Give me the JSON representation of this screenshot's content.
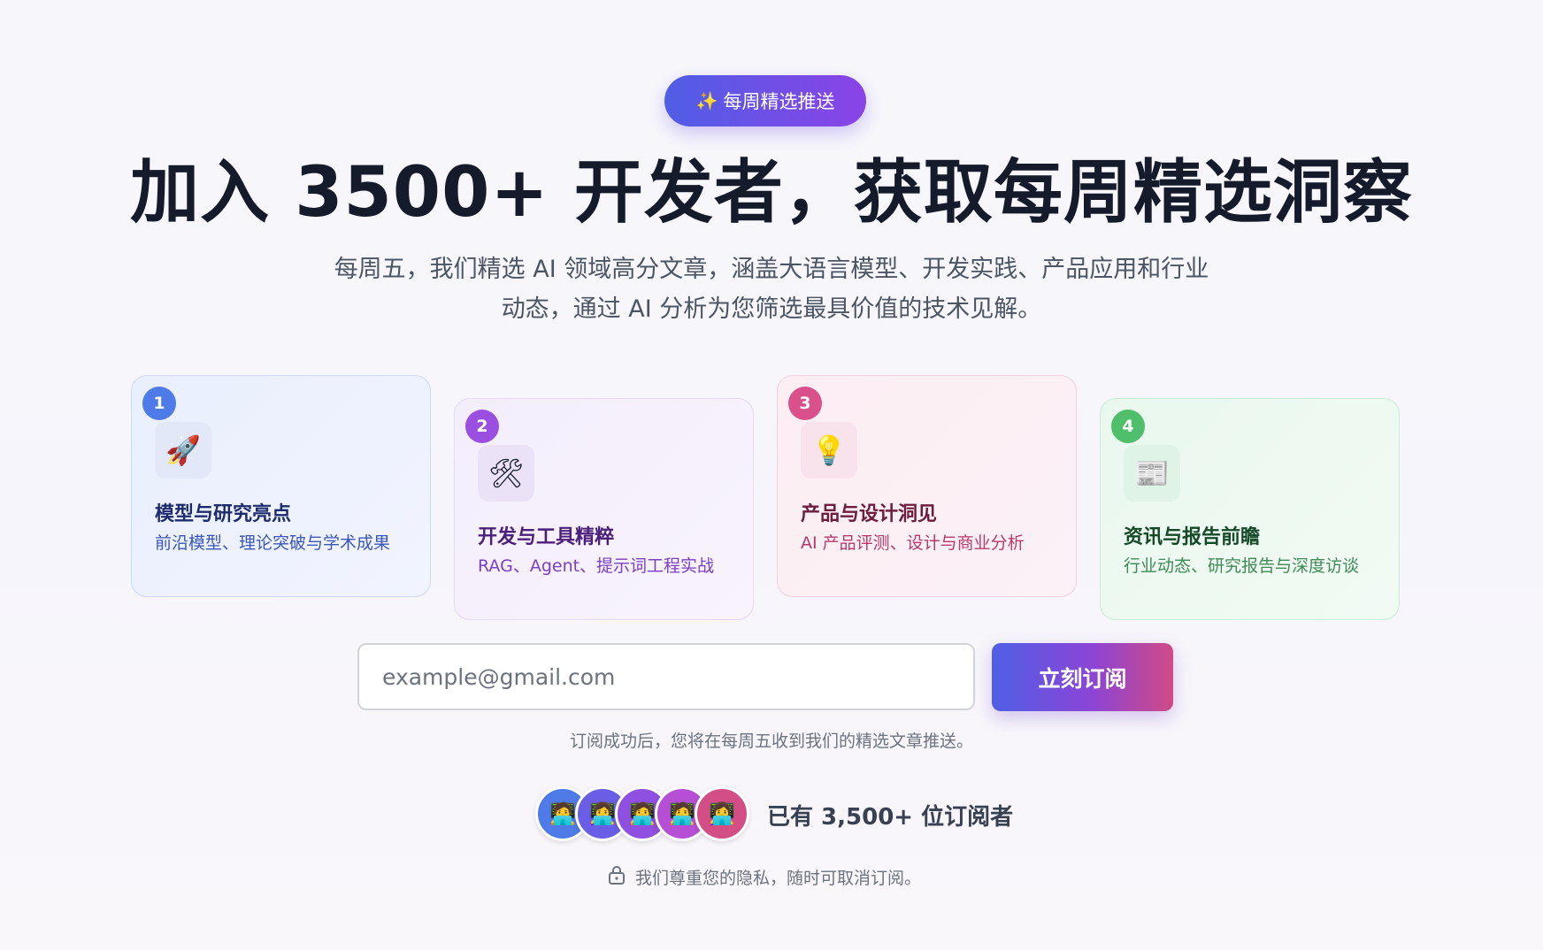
{
  "badge": {
    "icon": "sparkles-icon",
    "icon_glyph": "✨",
    "label": "每周精选推送"
  },
  "hero": {
    "title": "加入 3500+ 开发者，获取每周精选洞察",
    "subtitle_line1": "每周五，我们精选 AI 领域高分文章，涵盖大语言模型、开发实践、产品应用和行业",
    "subtitle_line2": "动态，通过 AI 分析为您筛选最具价值的技术见解。"
  },
  "cards": [
    {
      "number": "1",
      "icon": "rocket-icon",
      "icon_glyph": "🚀",
      "title": "模型与研究亮点",
      "desc": "前沿模型、理论突破与学术成果"
    },
    {
      "number": "2",
      "icon": "tools-icon",
      "icon_glyph": "🛠",
      "title": "开发与工具精粹",
      "desc": "RAG、Agent、提示词工程实战"
    },
    {
      "number": "3",
      "icon": "lightbulb-icon",
      "icon_glyph": "💡",
      "title": "产品与设计洞见",
      "desc": "AI 产品评测、设计与商业分析"
    },
    {
      "number": "4",
      "icon": "newspaper-icon",
      "icon_glyph": "📰",
      "title": "资讯与报告前瞻",
      "desc": "行业动态、研究报告与深度访谈"
    }
  ],
  "form": {
    "email_placeholder": "example@gmail.com",
    "subscribe_label": "立刻订阅",
    "note": "订阅成功后，您将在每周五收到我们的精选文章推送。"
  },
  "subscribers": {
    "avatar_glyphs": [
      "🧑‍💻",
      "👩‍💻",
      "🧑‍💻",
      "🧑‍💻",
      "👩‍💻"
    ],
    "avatar_colors": [
      "#4f7be8",
      "#6a5ee6",
      "#8f4fe0",
      "#b64fd6",
      "#d44e86"
    ],
    "text": "已有 3,500+ 位订阅者"
  },
  "privacy": {
    "icon": "lock-icon",
    "text": "我们尊重您的隐私，随时可取消订阅。"
  }
}
